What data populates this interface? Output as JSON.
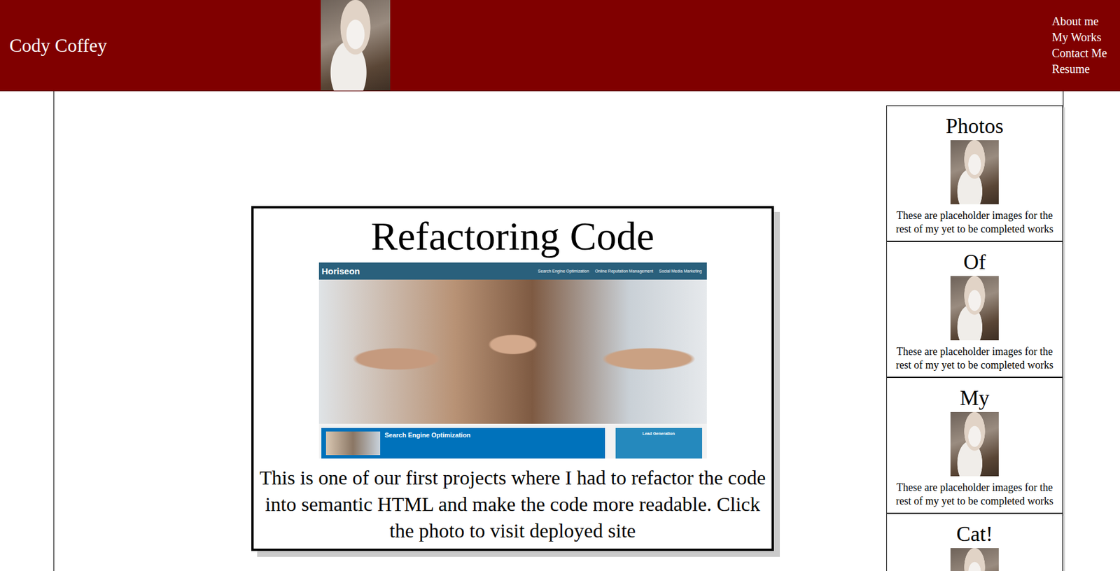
{
  "header": {
    "name": "Cody Coffey",
    "nav": [
      {
        "label": "About me"
      },
      {
        "label": "My Works"
      },
      {
        "label": "Contact Me"
      },
      {
        "label": "Resume"
      }
    ]
  },
  "featured": {
    "title": "Refactoring Code",
    "description": "This is one of our first projects where I had to refactor the code into semantic HTML and make the code more readable. Click the photo to visit deployed site",
    "screenshot": {
      "brand": "Horiseon",
      "nav": [
        "Search Engine Optimization",
        "Online Reputation Management",
        "Social Media Marketing"
      ],
      "sections": [
        {
          "title": "Search Engine Optimization",
          "color": "#0072bb"
        },
        {
          "title": "Lead Generation",
          "color": "#2589bd"
        }
      ]
    }
  },
  "sidebar": {
    "cards": [
      {
        "title": "Photos",
        "caption": "These are placeholder images for the rest of my yet to be completed works"
      },
      {
        "title": "Of",
        "caption": "These are placeholder images for the rest of my yet to be completed works"
      },
      {
        "title": "My",
        "caption": "These are placeholder images for the rest of my yet to be completed works"
      },
      {
        "title": "Cat!",
        "caption": ""
      }
    ]
  }
}
